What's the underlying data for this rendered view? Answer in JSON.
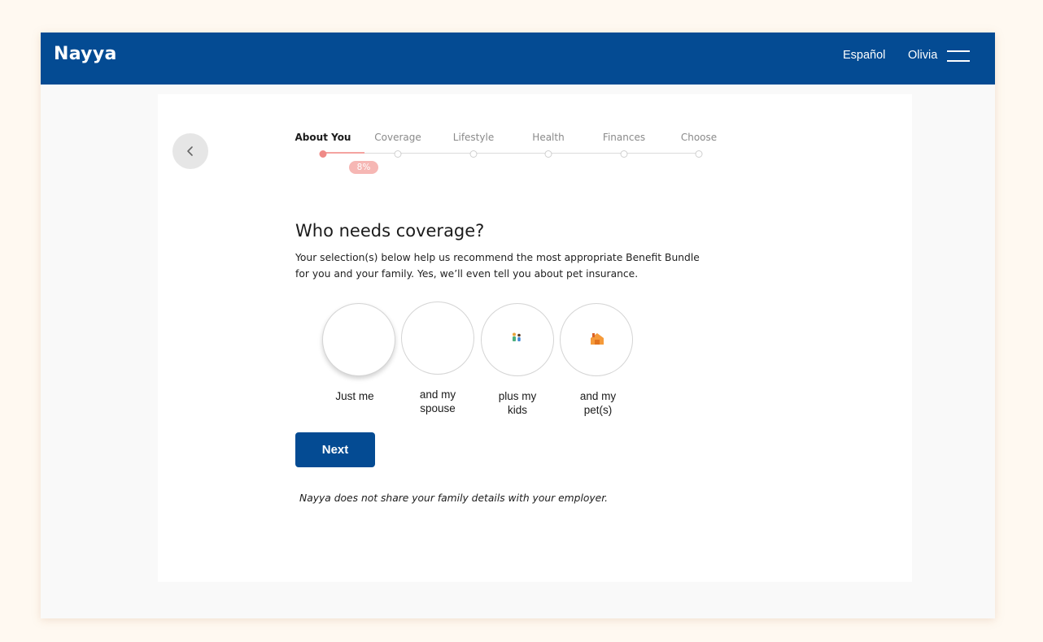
{
  "header": {
    "logo_text": "Nayya",
    "language_link": "Español",
    "user_name": "Olivia",
    "menu_icon": "hamburger-menu-icon",
    "background_color": "#044b93"
  },
  "back_icon": "chevron-left-icon",
  "progress": {
    "steps": [
      {
        "label": "About You",
        "active": true
      },
      {
        "label": "Coverage",
        "active": false
      },
      {
        "label": "Lifestyle",
        "active": false
      },
      {
        "label": "Health",
        "active": false
      },
      {
        "label": "Finances",
        "active": false
      },
      {
        "label": "Choose",
        "active": false
      }
    ],
    "percent_label": "8%",
    "percent": 8,
    "accent_color": "#ef8a87"
  },
  "question": {
    "title": "Who needs coverage?",
    "description": "Your selection(s) below help us recommend the most appropriate Benefit Bundle for you and your family. Yes, we’ll even tell you about pet insurance."
  },
  "options": [
    {
      "label": "Just me",
      "icon": "",
      "highlighted": true
    },
    {
      "label": "and my spouse",
      "icon": "",
      "highlighted": false
    },
    {
      "label": "plus my kids",
      "icon": "kids-icon",
      "highlighted": false
    },
    {
      "label": "and my pet(s)",
      "icon": "pet-house-icon",
      "highlighted": false
    }
  ],
  "next_button": {
    "label": "Next"
  },
  "privacy_note": "Nayya does not share your family details with your employer."
}
